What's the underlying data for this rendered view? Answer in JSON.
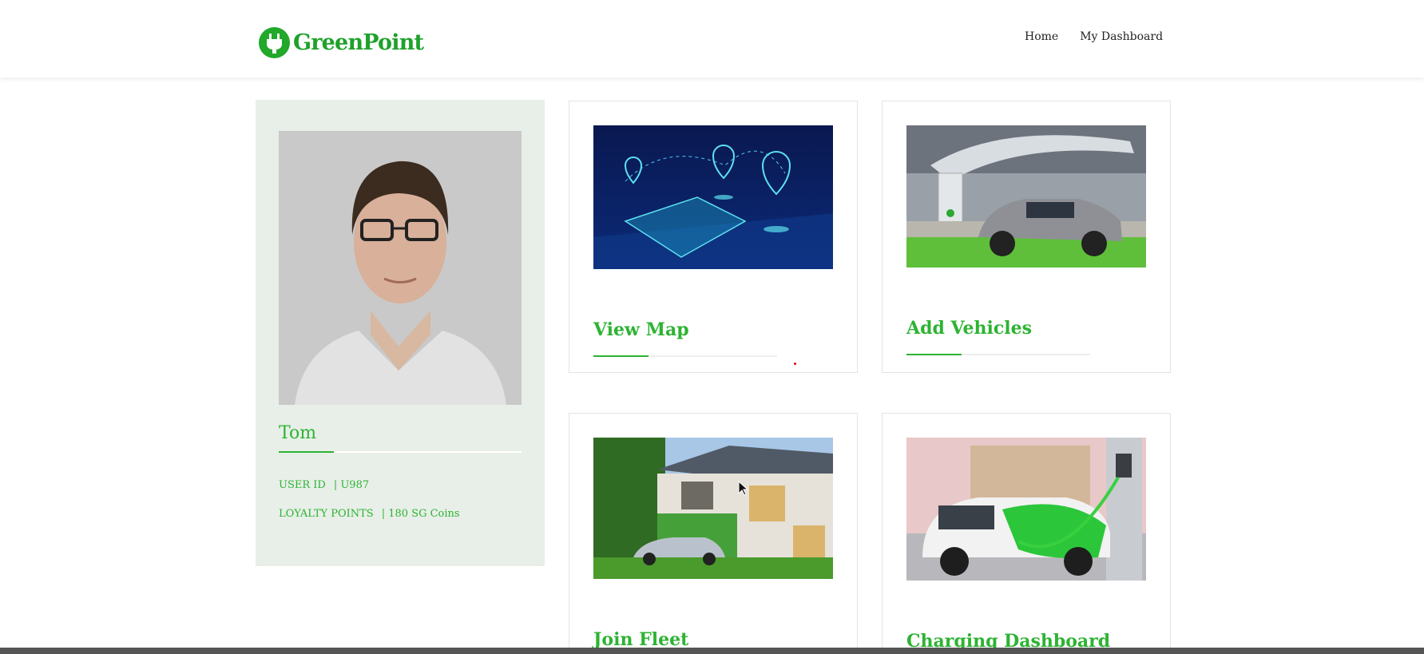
{
  "header": {
    "logo_text": "GreenPoint",
    "logo_icon": "plug-icon",
    "nav": [
      {
        "label": "Home"
      },
      {
        "label": "My Dashboard"
      }
    ]
  },
  "profile": {
    "name": "Tom",
    "user_id_label": "USER ID",
    "user_id_value": "| U987",
    "loyalty_label": "LOYALTY POINTS",
    "loyalty_value": "| 180 SG Coins"
  },
  "cards": [
    {
      "title": "View Map",
      "image": "map-technology-image"
    },
    {
      "title": "Add Vehicles",
      "image": "car-charging-station-image"
    },
    {
      "title": "Join Fleet",
      "image": "house-with-car-image"
    },
    {
      "title": "Charging Dashboard",
      "image": "green-ev-charging-image"
    }
  ],
  "colors": {
    "brand_green": "#2db332",
    "profile_bg": "#e8efe8"
  }
}
